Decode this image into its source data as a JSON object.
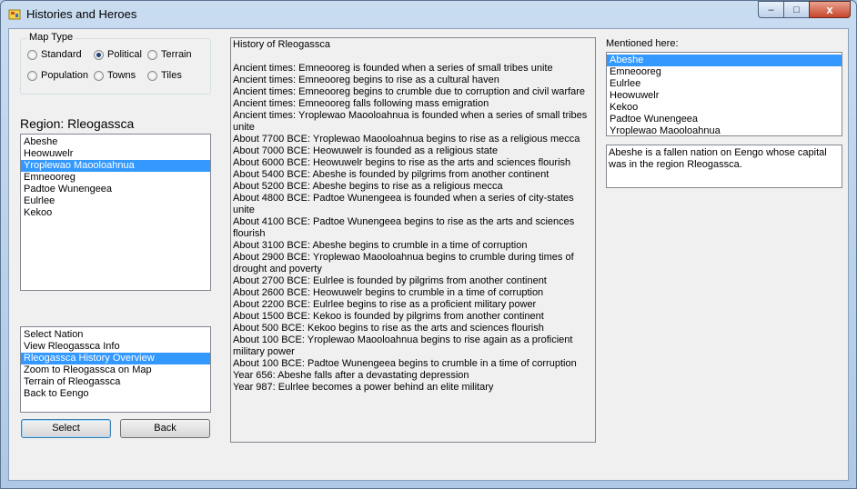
{
  "window": {
    "title": "Histories and Heroes",
    "caption_minimize": "–",
    "caption_maximize": "□",
    "caption_close": "x"
  },
  "map_type": {
    "label": "Map Type",
    "options": [
      {
        "label": "Standard",
        "checked": false
      },
      {
        "label": "Political",
        "checked": true
      },
      {
        "label": "Terrain",
        "checked": false
      },
      {
        "label": "Population",
        "checked": false
      },
      {
        "label": "Towns",
        "checked": false
      },
      {
        "label": "Tiles",
        "checked": false
      }
    ]
  },
  "region": {
    "label": "Region: Rleogassca",
    "nations": [
      "Abeshe",
      "Heowuwelr",
      "Yroplewao Maooloahnua",
      "Emneooreg",
      "Padtoe Wunengeea",
      "Eulrlee",
      "Kekoo"
    ],
    "selected_nation_index": 2
  },
  "actions": {
    "items": [
      "Select Nation",
      "View Rleogassca Info",
      "Rleogassca History Overview",
      "Zoom to Rleogassca on Map",
      "Terrain of Rleogassca",
      "Back to Eengo"
    ],
    "selected_index": 2
  },
  "buttons": {
    "select": "Select",
    "back": "Back"
  },
  "history": {
    "title": "History of Rleogassca",
    "lines": [
      "Ancient times: Emneooreg is founded when a series of small tribes unite",
      "Ancient times: Emneooreg begins to rise as a cultural haven",
      "Ancient times: Emneooreg begins to crumble due to corruption and civil warfare",
      "Ancient times: Emneooreg falls following mass emigration",
      "Ancient times: Yroplewao Maooloahnua is founded when a series of small tribes unite",
      "About 7700 BCE: Yroplewao Maooloahnua begins to rise as a religious mecca",
      "About 7000 BCE: Heowuwelr is founded as a religious state",
      "About 6000 BCE: Heowuwelr begins to rise as the arts and sciences flourish",
      "About 5400 BCE: Abeshe is founded by pilgrims from another continent",
      "About 5200 BCE: Abeshe begins to rise as a religious mecca",
      "About 4800 BCE: Padtoe Wunengeea is founded when a series of city-states unite",
      "About 4100 BCE: Padtoe Wunengeea begins to rise as the arts and sciences flourish",
      "About 3100 BCE: Abeshe begins to crumble in a time of corruption",
      "About 2900 BCE: Yroplewao Maooloahnua begins to crumble during times of drought and poverty",
      "About 2700 BCE: Eulrlee is founded by pilgrims from another continent",
      "About 2600 BCE: Heowuwelr begins to crumble in a time of corruption",
      "About 2200 BCE: Eulrlee begins to rise as a proficient military power",
      "About 1500 BCE: Kekoo is founded by pilgrims from another continent",
      "About 500 BCE: Kekoo begins to rise as the arts and sciences flourish",
      "About 100 BCE: Yroplewao Maooloahnua begins to rise again as a proficient military power",
      "About 100 BCE: Padtoe Wunengeea begins to crumble in a time of corruption",
      "Year 656: Abeshe falls after a devastating depression",
      "Year 987: Eulrlee becomes a power behind an elite military"
    ]
  },
  "mentioned": {
    "label": "Mentioned here:",
    "items": [
      "Abeshe",
      "Emneooreg",
      "Eulrlee",
      "Heowuwelr",
      "Kekoo",
      "Padtoe Wunengeea",
      "Yroplewao Maooloahnua"
    ],
    "selected_index": 0,
    "description": "Abeshe is a fallen nation on Eengo whose capital was in the region Rleogassca."
  }
}
